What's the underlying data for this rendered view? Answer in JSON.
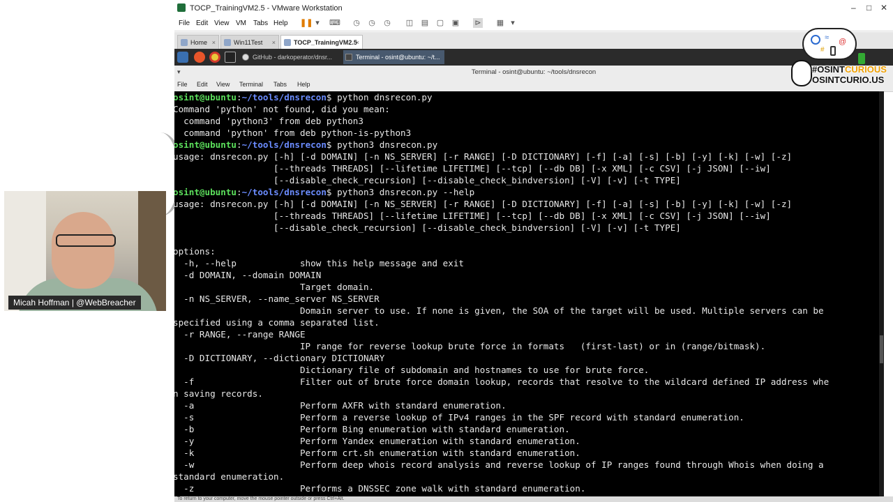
{
  "vmware": {
    "title": "TOCP_TrainingVM2.5 - VMware Workstation",
    "menu": [
      "File",
      "Edit",
      "View",
      "VM",
      "Tabs",
      "Help"
    ],
    "tabs": [
      {
        "label": "Home"
      },
      {
        "label": "Win11Test"
      },
      {
        "label": "TOCP_TrainingVM2.5"
      }
    ]
  },
  "guest_panel": {
    "tasks": [
      {
        "label": "GitHub - darkoperator/dnsr..."
      },
      {
        "label": "Terminal - osint@ubuntu: ~/t..."
      }
    ]
  },
  "terminal": {
    "title": "Terminal - osint@ubuntu: ~/tools/dnsrecon",
    "menu": [
      "File",
      "Edit",
      "View",
      "Terminal",
      "Tabs",
      "Help"
    ],
    "prompt_user": "osint@ubuntu",
    "prompt_path": "~/tools/dnsrecon",
    "lines": [
      {
        "type": "prompt",
        "cmd": " python dnsrecon.py"
      },
      {
        "type": "text",
        "text": "Command 'python' not found, did you mean:"
      },
      {
        "type": "text",
        "text": "  command 'python3' from deb python3"
      },
      {
        "type": "text",
        "text": "  command 'python' from deb python-is-python3"
      },
      {
        "type": "prompt",
        "cmd": " python3 dnsrecon.py"
      },
      {
        "type": "text",
        "text": "usage: dnsrecon.py [-h] [-d DOMAIN] [-n NS_SERVER] [-r RANGE] [-D DICTIONARY] [-f] [-a] [-s] [-b] [-y] [-k] [-w] [-z]"
      },
      {
        "type": "text",
        "text": "                   [--threads THREADS] [--lifetime LIFETIME] [--tcp] [--db DB] [-x XML] [-c CSV] [-j JSON] [--iw]"
      },
      {
        "type": "text",
        "text": "                   [--disable_check_recursion] [--disable_check_bindversion] [-V] [-v] [-t TYPE]"
      },
      {
        "type": "prompt",
        "cmd": " python3 dnsrecon.py --help"
      },
      {
        "type": "text",
        "text": "usage: dnsrecon.py [-h] [-d DOMAIN] [-n NS_SERVER] [-r RANGE] [-D DICTIONARY] [-f] [-a] [-s] [-b] [-y] [-k] [-w] [-z]"
      },
      {
        "type": "text",
        "text": "                   [--threads THREADS] [--lifetime LIFETIME] [--tcp] [--db DB] [-x XML] [-c CSV] [-j JSON] [--iw]"
      },
      {
        "type": "text",
        "text": "                   [--disable_check_recursion] [--disable_check_bindversion] [-V] [-v] [-t TYPE]"
      },
      {
        "type": "text",
        "text": ""
      },
      {
        "type": "text",
        "text": "options:"
      },
      {
        "type": "text",
        "text": "  -h, --help            show this help message and exit"
      },
      {
        "type": "text",
        "text": "  -d DOMAIN, --domain DOMAIN"
      },
      {
        "type": "text",
        "text": "                        Target domain."
      },
      {
        "type": "text",
        "text": "  -n NS_SERVER, --name_server NS_SERVER"
      },
      {
        "type": "text",
        "text": "                        Domain server to use. If none is given, the SOA of the target will be used. Multiple servers can be"
      },
      {
        "type": "text",
        "text": "specified using a comma separated list."
      },
      {
        "type": "text",
        "text": "  -r RANGE, --range RANGE"
      },
      {
        "type": "text",
        "text": "                        IP range for reverse lookup brute force in formats   (first-last) or in (range/bitmask)."
      },
      {
        "type": "text",
        "text": "  -D DICTIONARY, --dictionary DICTIONARY"
      },
      {
        "type": "text",
        "text": "                        Dictionary file of subdomain and hostnames to use for brute force."
      },
      {
        "type": "text",
        "text": "  -f                    Filter out of brute force domain lookup, records that resolve to the wildcard defined IP address whe"
      },
      {
        "type": "text",
        "text": "n saving records."
      },
      {
        "type": "text",
        "text": "  -a                    Perform AXFR with standard enumeration."
      },
      {
        "type": "text",
        "text": "  -s                    Perform a reverse lookup of IPv4 ranges in the SPF record with standard enumeration."
      },
      {
        "type": "text",
        "text": "  -b                    Perform Bing enumeration with standard enumeration."
      },
      {
        "type": "text",
        "text": "  -y                    Perform Yandex enumeration with standard enumeration."
      },
      {
        "type": "text",
        "text": "  -k                    Perform crt.sh enumeration with standard enumeration."
      },
      {
        "type": "text",
        "text": "  -w                    Perform deep whois record analysis and reverse lookup of IP ranges found through Whois when doing a"
      },
      {
        "type": "text",
        "text": "standard enumeration."
      },
      {
        "type": "text",
        "text": "  -z                    Performs a DNSSEC zone walk with standard enumeration."
      }
    ],
    "status": "To return to your computer, move the mouse pointer outside or press Ctrl+Alt."
  },
  "webcam": {
    "label": "Micah Hoffman | @WebBreacher"
  },
  "osint_badge": {
    "line1_a": "#OSINT",
    "line1_b": "CURIOUS",
    "line2": "OSINTCURIO.US"
  },
  "colors": {
    "prompt_user": "#5ce05c",
    "prompt_path": "#6b8cff",
    "terminal_bg": "#000000",
    "accent_orange": "#f0a000"
  }
}
